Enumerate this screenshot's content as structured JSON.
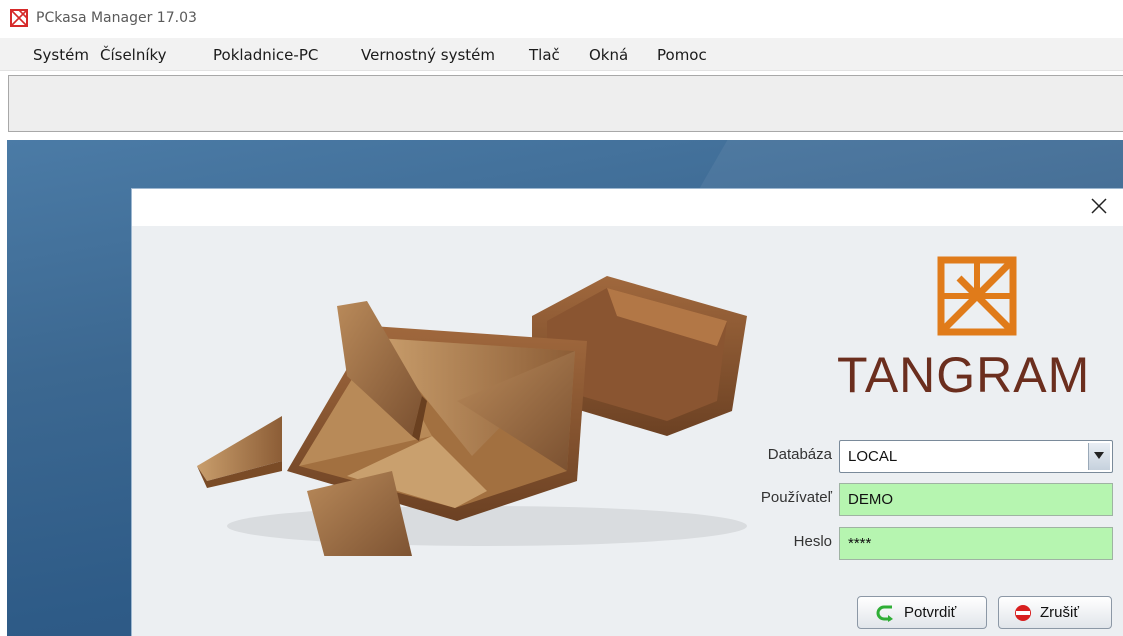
{
  "window": {
    "title": "PCkasa Manager 17.03",
    "icon": "pckasa-app-icon"
  },
  "menu": {
    "items": [
      "Systém",
      "Číselníky",
      "Pokladnice-PC",
      "Vernostný systém",
      "Tlač",
      "Okná",
      "Pomoc"
    ]
  },
  "dialog": {
    "close_icon": "close-icon",
    "logo_text": "TANGRAM",
    "logo_color": "#e07b1a",
    "brand_text_color": "#6b2e1e",
    "form": {
      "database_label": "Databáza",
      "database_value": "LOCAL",
      "user_label": "Používateľ",
      "user_value": "DEMO",
      "password_label": "Heslo",
      "password_value": "****",
      "field_color": "#b6f5b0"
    },
    "buttons": {
      "confirm": "Potvrdiť",
      "cancel": "Zrušiť"
    }
  }
}
